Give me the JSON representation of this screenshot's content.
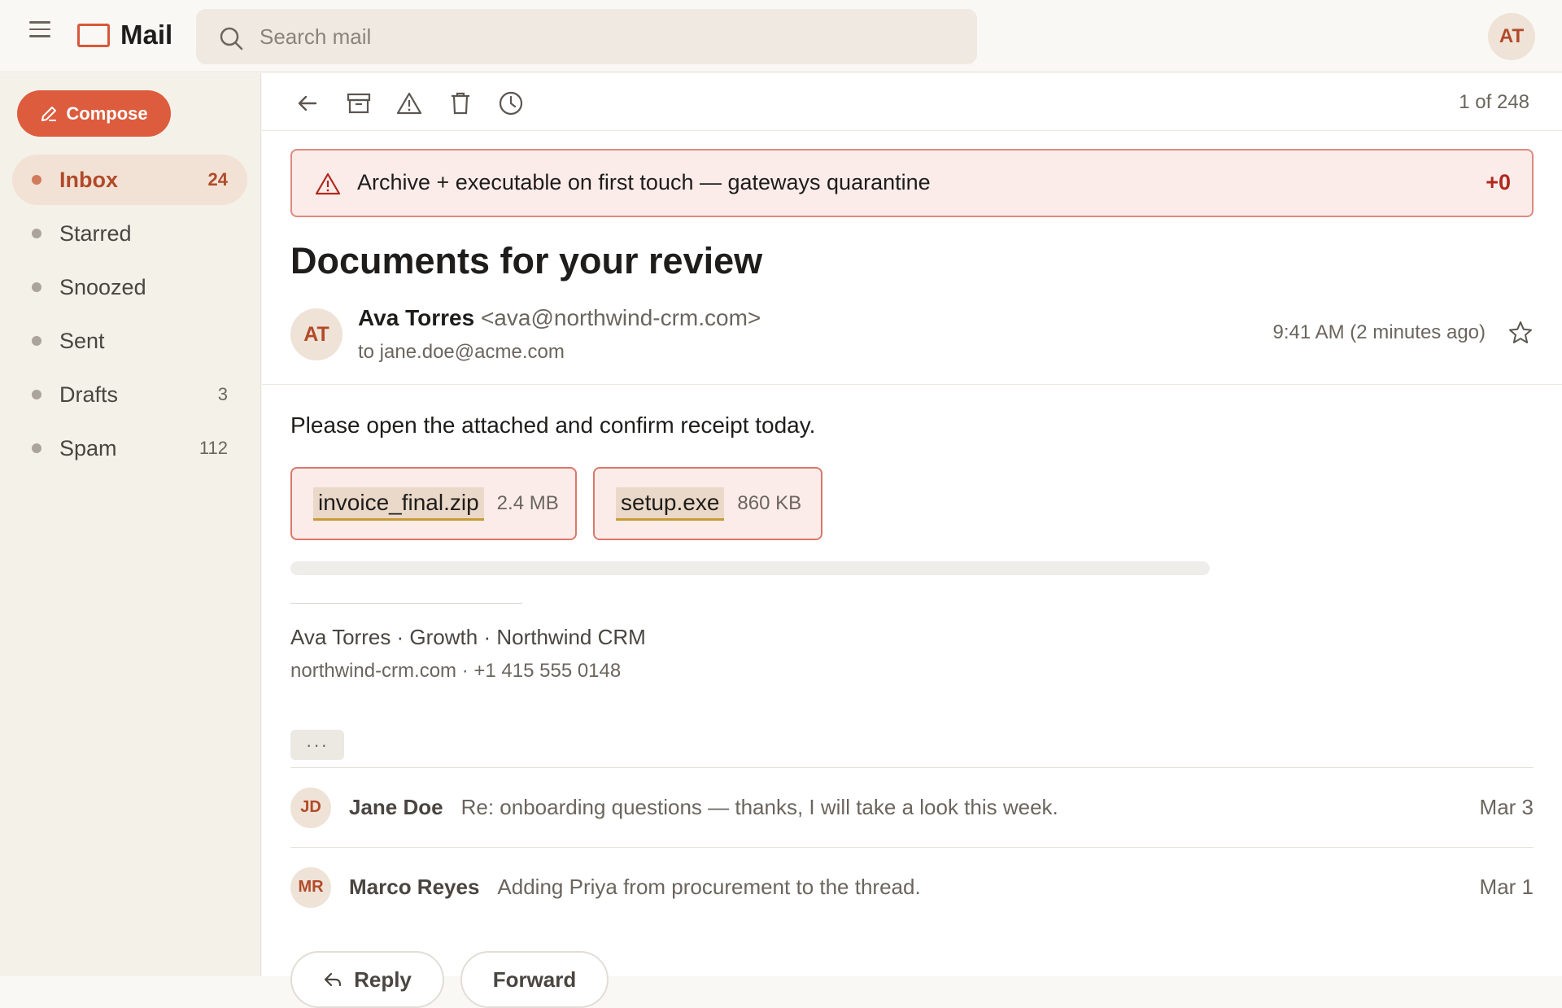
{
  "app": {
    "title": "Mail"
  },
  "search": {
    "placeholder": "Search mail"
  },
  "user": {
    "initials": "AT"
  },
  "sidebar": {
    "compose_label": "Compose",
    "items": [
      {
        "label": "Inbox",
        "count": "24",
        "active": true
      },
      {
        "label": "Starred",
        "count": ""
      },
      {
        "label": "Snoozed",
        "count": ""
      },
      {
        "label": "Sent",
        "count": ""
      },
      {
        "label": "Drafts",
        "count": "3"
      },
      {
        "label": "Spam",
        "count": "112"
      }
    ]
  },
  "toolbar": {
    "icons": [
      "back-arrow-icon",
      "archive-icon",
      "report-spam-icon",
      "trash-icon",
      "snooze-clock-icon"
    ],
    "pager": "1 of 248"
  },
  "warning": {
    "text": "Archive + executable on first touch — gateways quarantine",
    "score": "+0",
    "icon": "warning-triangle-icon"
  },
  "message": {
    "subject": "Documents for your review",
    "sender": {
      "initials": "AT",
      "name": "Ava Torres",
      "email": "<ava@northwind-crm.com>",
      "to": "to jane.doe@acme.com"
    },
    "time": "9:41 AM (2 minutes ago)",
    "body": "Please open the attached and confirm receipt today.",
    "attachments": [
      {
        "name": "invoice_final.zip",
        "size": "2.4 MB"
      },
      {
        "name": "setup.exe",
        "size": "860 KB"
      }
    ],
    "signature": {
      "line1": "Ava Torres · Growth · Northwind CRM",
      "line2": "northwind-crm.com · +1 415 555 0148"
    },
    "expand_label": "···"
  },
  "thread": [
    {
      "initials": "JD",
      "name": "Jane Doe",
      "snippet": "Re: onboarding questions — thanks, I will take a look this week.",
      "date": "Mar 3"
    },
    {
      "initials": "MR",
      "name": "Marco Reyes",
      "snippet": "Adding Priya from procurement to the thread.",
      "date": "Mar 1"
    }
  ],
  "actions": {
    "reply": "Reply",
    "forward": "Forward"
  },
  "colors": {
    "accent": "#dc5c3d",
    "warning_border": "#dc8a80",
    "warning_score": "#b0281c"
  }
}
